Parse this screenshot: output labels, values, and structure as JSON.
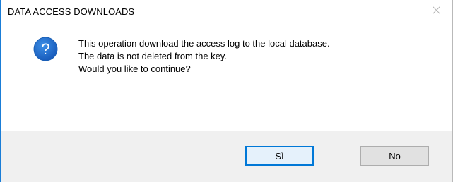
{
  "window": {
    "title": "DATA ACCESS DOWNLOADS",
    "close_icon": "close-icon"
  },
  "message": {
    "icon": "question-icon",
    "icon_color": "#1f6fd1",
    "lines": [
      "This operation download the access log to the local database.",
      "The data is not deleted from the key.",
      "Would you like to continue?"
    ]
  },
  "buttons": {
    "yes_label": "Sì",
    "no_label": "No",
    "default_button": "yes",
    "accent_color": "#0078d7"
  }
}
